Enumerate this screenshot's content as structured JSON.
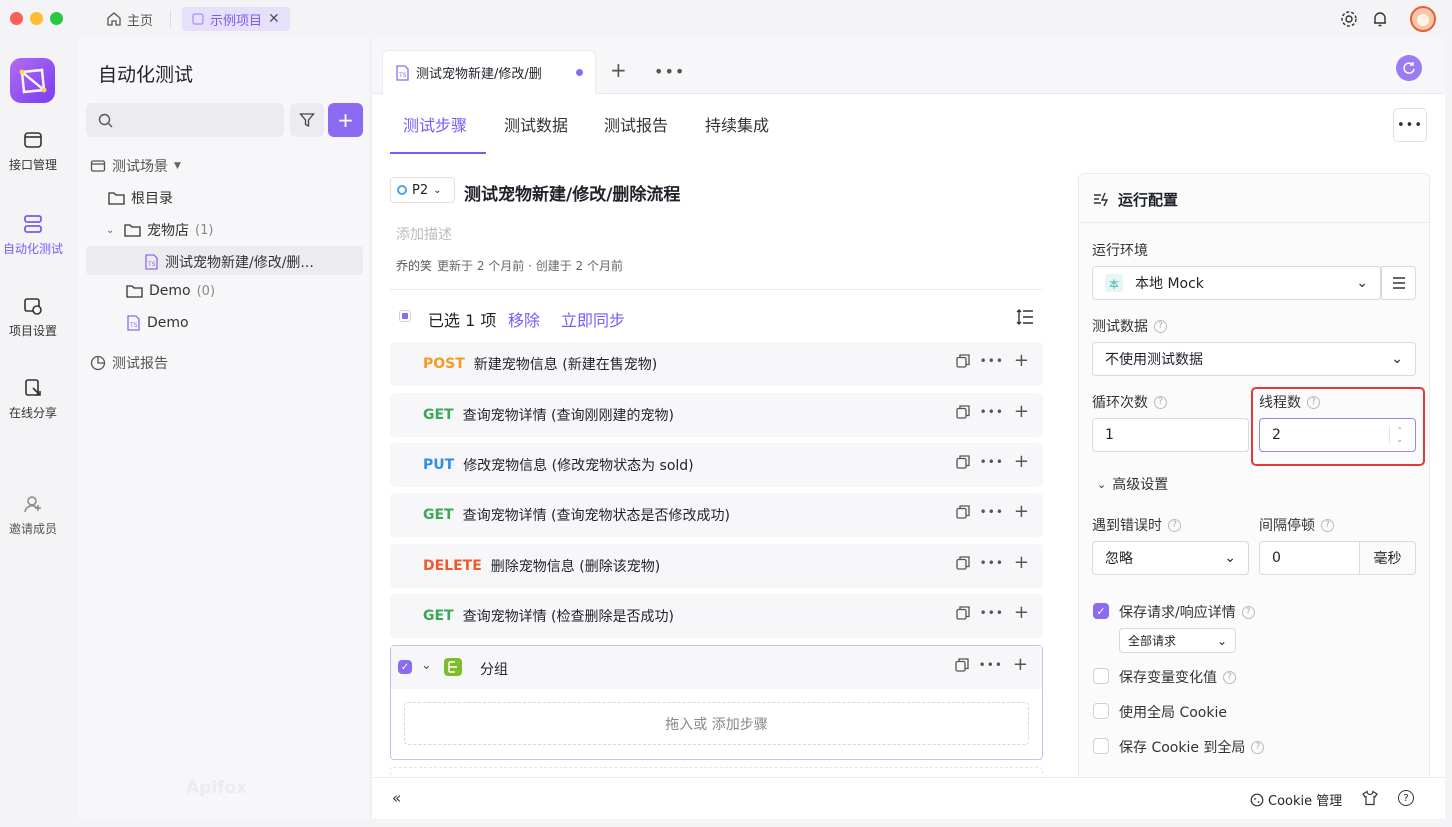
{
  "titlebar": {
    "home_label": "主页",
    "project_tab": "示例项目"
  },
  "rail": [
    {
      "label": "接口管理",
      "icon": "api-icon"
    },
    {
      "label": "自动化测试",
      "icon": "automation-icon",
      "active": true
    },
    {
      "label": "项目设置",
      "icon": "settings-icon"
    },
    {
      "label": "在线分享",
      "icon": "share-icon"
    },
    {
      "label": "邀请成员",
      "icon": "invite-icon"
    }
  ],
  "sidebar": {
    "title": "自动化测试",
    "search_placeholder": "",
    "section_scenes": "测试场景",
    "root": "根目录",
    "folder_petshop": "宠物店",
    "folder_petshop_count": "(1)",
    "scene_item": "测试宠物新建/修改/删...",
    "folder_demo": "Demo",
    "folder_demo_count": "(0)",
    "scene_demo": "Demo",
    "section_reports": "测试报告",
    "watermark": "Apifox"
  },
  "main": {
    "file_tab": "测试宠物新建/修改/删",
    "tabs": [
      "测试步骤",
      "测试数据",
      "测试报告",
      "持续集成"
    ],
    "priority": "P2",
    "scene_title": "测试宠物新建/修改/删除流程",
    "description_placeholder": "添加描述",
    "author": "乔的笑",
    "meta": "更新于 2 个月前 · 创建于 2 个月前",
    "selection": {
      "text": "已选 1 项",
      "remove": "移除",
      "sync": "立即同步"
    },
    "steps": [
      {
        "method": "POST",
        "color": "#f59a23",
        "text": "新建宠物信息 (新建在售宠物)"
      },
      {
        "method": "GET",
        "color": "#3aa856",
        "text": "查询宠物详情 (查询刚刚建的宠物)"
      },
      {
        "method": "PUT",
        "color": "#2e8ee8",
        "text": "修改宠物信息 (修改宠物状态为 sold)"
      },
      {
        "method": "GET",
        "color": "#3aa856",
        "text": "查询宠物详情 (查询宠物状态是否修改成功)"
      },
      {
        "method": "DELETE",
        "color": "#ee5a2e",
        "text": "删除宠物信息 (删除该宠物)"
      },
      {
        "method": "GET",
        "color": "#3aa856",
        "text": "查询宠物详情 (检查删除是否成功)"
      }
    ],
    "group_label": "分组",
    "group_drop": "拖入或 添加步骤"
  },
  "config": {
    "title": "运行配置",
    "env_label": "运行环境",
    "env_badge": "本",
    "env_value": "本地 Mock",
    "data_label": "测试数据",
    "data_value": "不使用测试数据",
    "loop_label": "循环次数",
    "loop_value": "1",
    "thread_label": "线程数",
    "thread_value": "2",
    "advanced": "高级设置",
    "error_label": "遇到错误时",
    "error_value": "忽略",
    "interval_label": "间隔停顿",
    "interval_value": "0",
    "interval_unit": "毫秒",
    "save_req": "保存请求/响应详情",
    "save_req_option": "全部请求",
    "save_var": "保存变量变化值",
    "use_cookie": "使用全局 Cookie",
    "save_cookie": "保存 Cookie 到全局"
  },
  "footer": {
    "cookie": "Cookie 管理"
  },
  "colors": {
    "accent": "#7a5af8",
    "highlight": "#e5383b"
  }
}
